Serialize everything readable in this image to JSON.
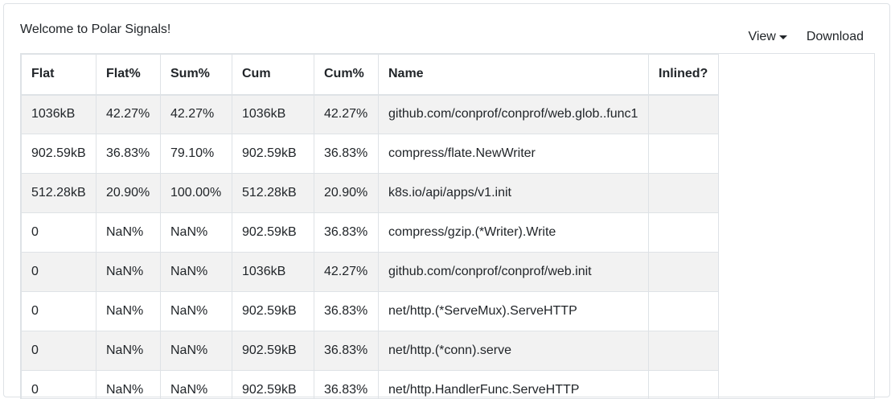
{
  "header": {
    "welcome": "Welcome to Polar Signals!"
  },
  "toolbar": {
    "view_label": "View",
    "download_label": "Download"
  },
  "table": {
    "columns": [
      "Flat",
      "Flat%",
      "Sum%",
      "Cum",
      "Cum%",
      "Name",
      "Inlined?"
    ],
    "rows": [
      [
        "1036kB",
        "42.27%",
        "42.27%",
        "1036kB",
        "42.27%",
        "github.com/conprof/conprof/web.glob..func1",
        ""
      ],
      [
        "902.59kB",
        "36.83%",
        "79.10%",
        "902.59kB",
        "36.83%",
        "compress/flate.NewWriter",
        ""
      ],
      [
        "512.28kB",
        "20.90%",
        "100.00%",
        "512.28kB",
        "20.90%",
        "k8s.io/api/apps/v1.init",
        ""
      ],
      [
        "0",
        "NaN%",
        "NaN%",
        "902.59kB",
        "36.83%",
        "compress/gzip.(*Writer).Write",
        ""
      ],
      [
        "0",
        "NaN%",
        "NaN%",
        "1036kB",
        "42.27%",
        "github.com/conprof/conprof/web.init",
        ""
      ],
      [
        "0",
        "NaN%",
        "NaN%",
        "902.59kB",
        "36.83%",
        "net/http.(*ServeMux).ServeHTTP",
        ""
      ],
      [
        "0",
        "NaN%",
        "NaN%",
        "902.59kB",
        "36.83%",
        "net/http.(*conn).serve",
        ""
      ],
      [
        "0",
        "NaN%",
        "NaN%",
        "902.59kB",
        "36.83%",
        "net/http.HandlerFunc.ServeHTTP",
        ""
      ]
    ]
  }
}
